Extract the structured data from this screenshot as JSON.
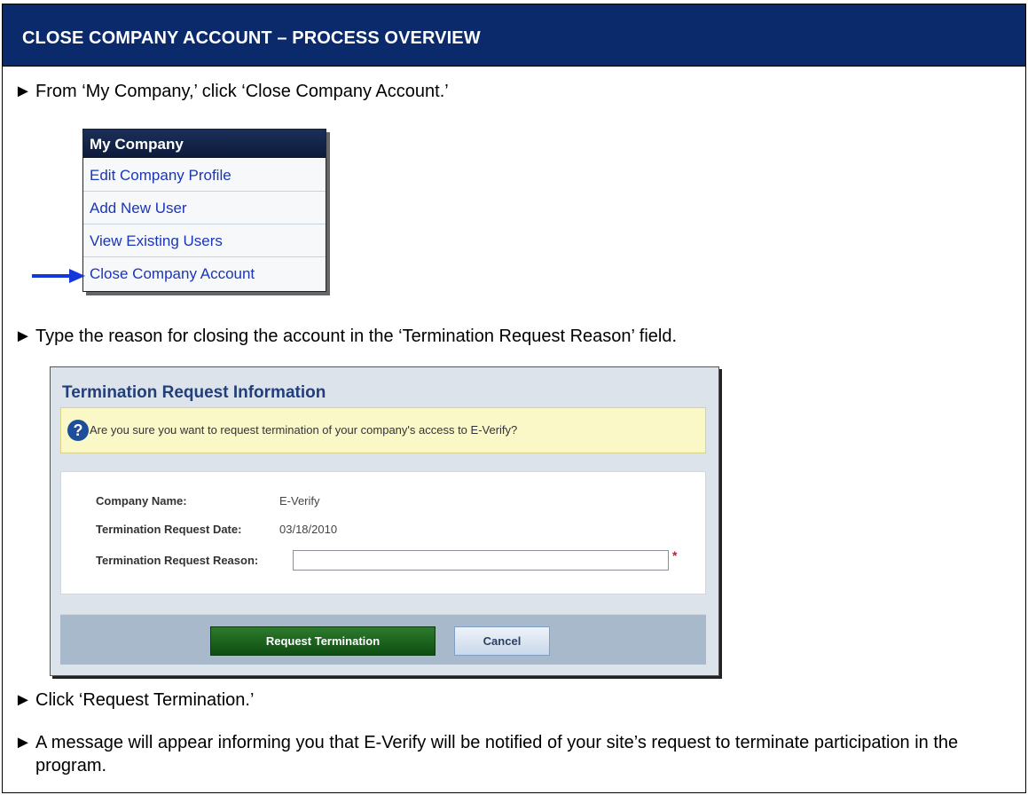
{
  "header": {
    "title": "CLOSE COMPANY ACCOUNT – PROCESS OVERVIEW"
  },
  "steps": [
    "From ‘My Company,’ click ‘Close Company Account.’",
    "Type the reason for closing the account in the ‘Termination Request Reason’ field.",
    "Click ‘Request Termination.’",
    "A message will appear informing you that E-Verify will be notified of your site’s request to terminate participation in the program."
  ],
  "bullet": "►",
  "menu": {
    "title": "My Company",
    "items": [
      {
        "label": "Edit Company Profile"
      },
      {
        "label": "Add New User"
      },
      {
        "label": "View Existing Users"
      },
      {
        "label": "Close Company Account"
      }
    ]
  },
  "panel": {
    "title": "Termination Request Information",
    "warning": "Are you sure you want to request termination of your company's access to E-Verify?",
    "fields": {
      "company_name_label": "Company Name:",
      "company_name_value": "E-Verify",
      "date_label": "Termination Request Date:",
      "date_value": "03/18/2010",
      "reason_label": "Termination Request Reason:",
      "reason_value": ""
    },
    "required_marker": "*",
    "buttons": {
      "request": "Request Termination",
      "cancel": "Cancel"
    }
  },
  "colors": {
    "header_bg": "#0b2a6b",
    "menu_link": "#1a36b8",
    "arrow": "#1437d9",
    "request_button": "#1f6a1f"
  }
}
